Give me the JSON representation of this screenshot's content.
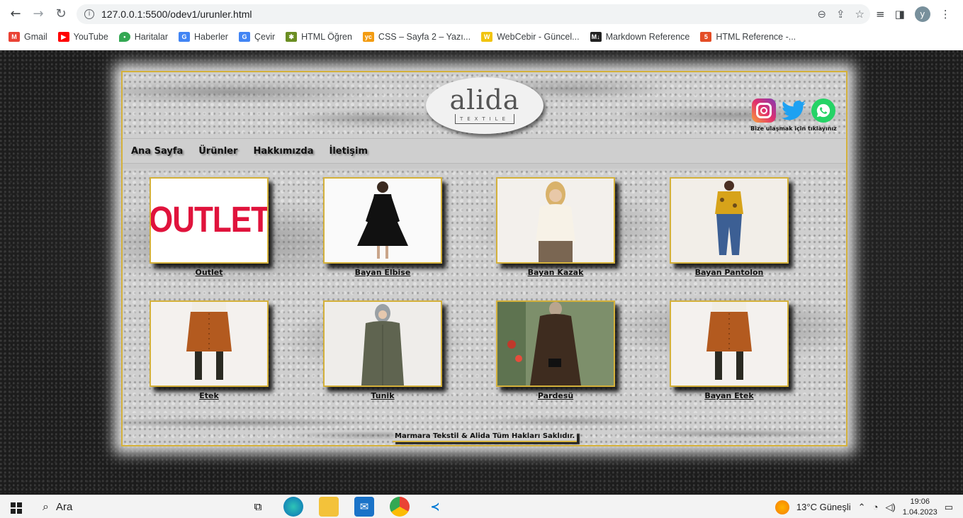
{
  "browser": {
    "url": "127.0.0.1:5500/odev1/urunler.html",
    "profile_initial": "y",
    "bookmarks": [
      {
        "label": "Gmail",
        "icon": "gmail-icon",
        "color": "#ea4335"
      },
      {
        "label": "YouTube",
        "icon": "youtube-icon",
        "color": "#ff0000"
      },
      {
        "label": "Haritalar",
        "icon": "maps-icon",
        "color": "#34a853"
      },
      {
        "label": "Haberler",
        "icon": "news-icon",
        "color": "#4285f4"
      },
      {
        "label": "Çevir",
        "icon": "translate-icon",
        "color": "#4285f4"
      },
      {
        "label": "HTML Öğren",
        "icon": "bug-icon",
        "color": "#6b8e23"
      },
      {
        "label": "CSS – Sayfa 2 – Yazı...",
        "icon": "ycss-icon",
        "color": "#f39c12"
      },
      {
        "label": "WebCebir - Güncel...",
        "icon": "w-icon",
        "color": "#f1c40f"
      },
      {
        "label": "Markdown Reference",
        "icon": "markdown-icon",
        "color": "#222222"
      },
      {
        "label": "HTML Reference -...",
        "icon": "html-ref-icon",
        "color": "#e44d26"
      }
    ]
  },
  "site": {
    "logo_word": "alida",
    "logo_sub": "TEXTILE",
    "social_caption": "Bize ulaşmak için tıklayınız",
    "nav": [
      "Ana Sayfa",
      "Ürünler",
      "Hakkımızda",
      "İletişim"
    ],
    "products": [
      {
        "label": "Outlet",
        "image": "outlet-banner",
        "banner_text": "OUTLET"
      },
      {
        "label": "Bayan Elbise",
        "image": "black-dress"
      },
      {
        "label": "Bayan Kazak",
        "image": "cream-sweater"
      },
      {
        "label": "Bayan Pantolon",
        "image": "blue-jeans"
      },
      {
        "label": "Etek",
        "image": "brown-skirt"
      },
      {
        "label": "Tunik",
        "image": "olive-tunic"
      },
      {
        "label": "Pardesü",
        "image": "brown-coat"
      },
      {
        "label": "Bayan Etek",
        "image": "brown-skirt"
      }
    ],
    "footer": "Marmara Tekstil & Alida Tüm Hakları Saklıdır."
  },
  "taskbar": {
    "search_label": "Ara",
    "weather": "13°C  Güneşli",
    "time": "19:06",
    "date": "1.04.2023"
  }
}
